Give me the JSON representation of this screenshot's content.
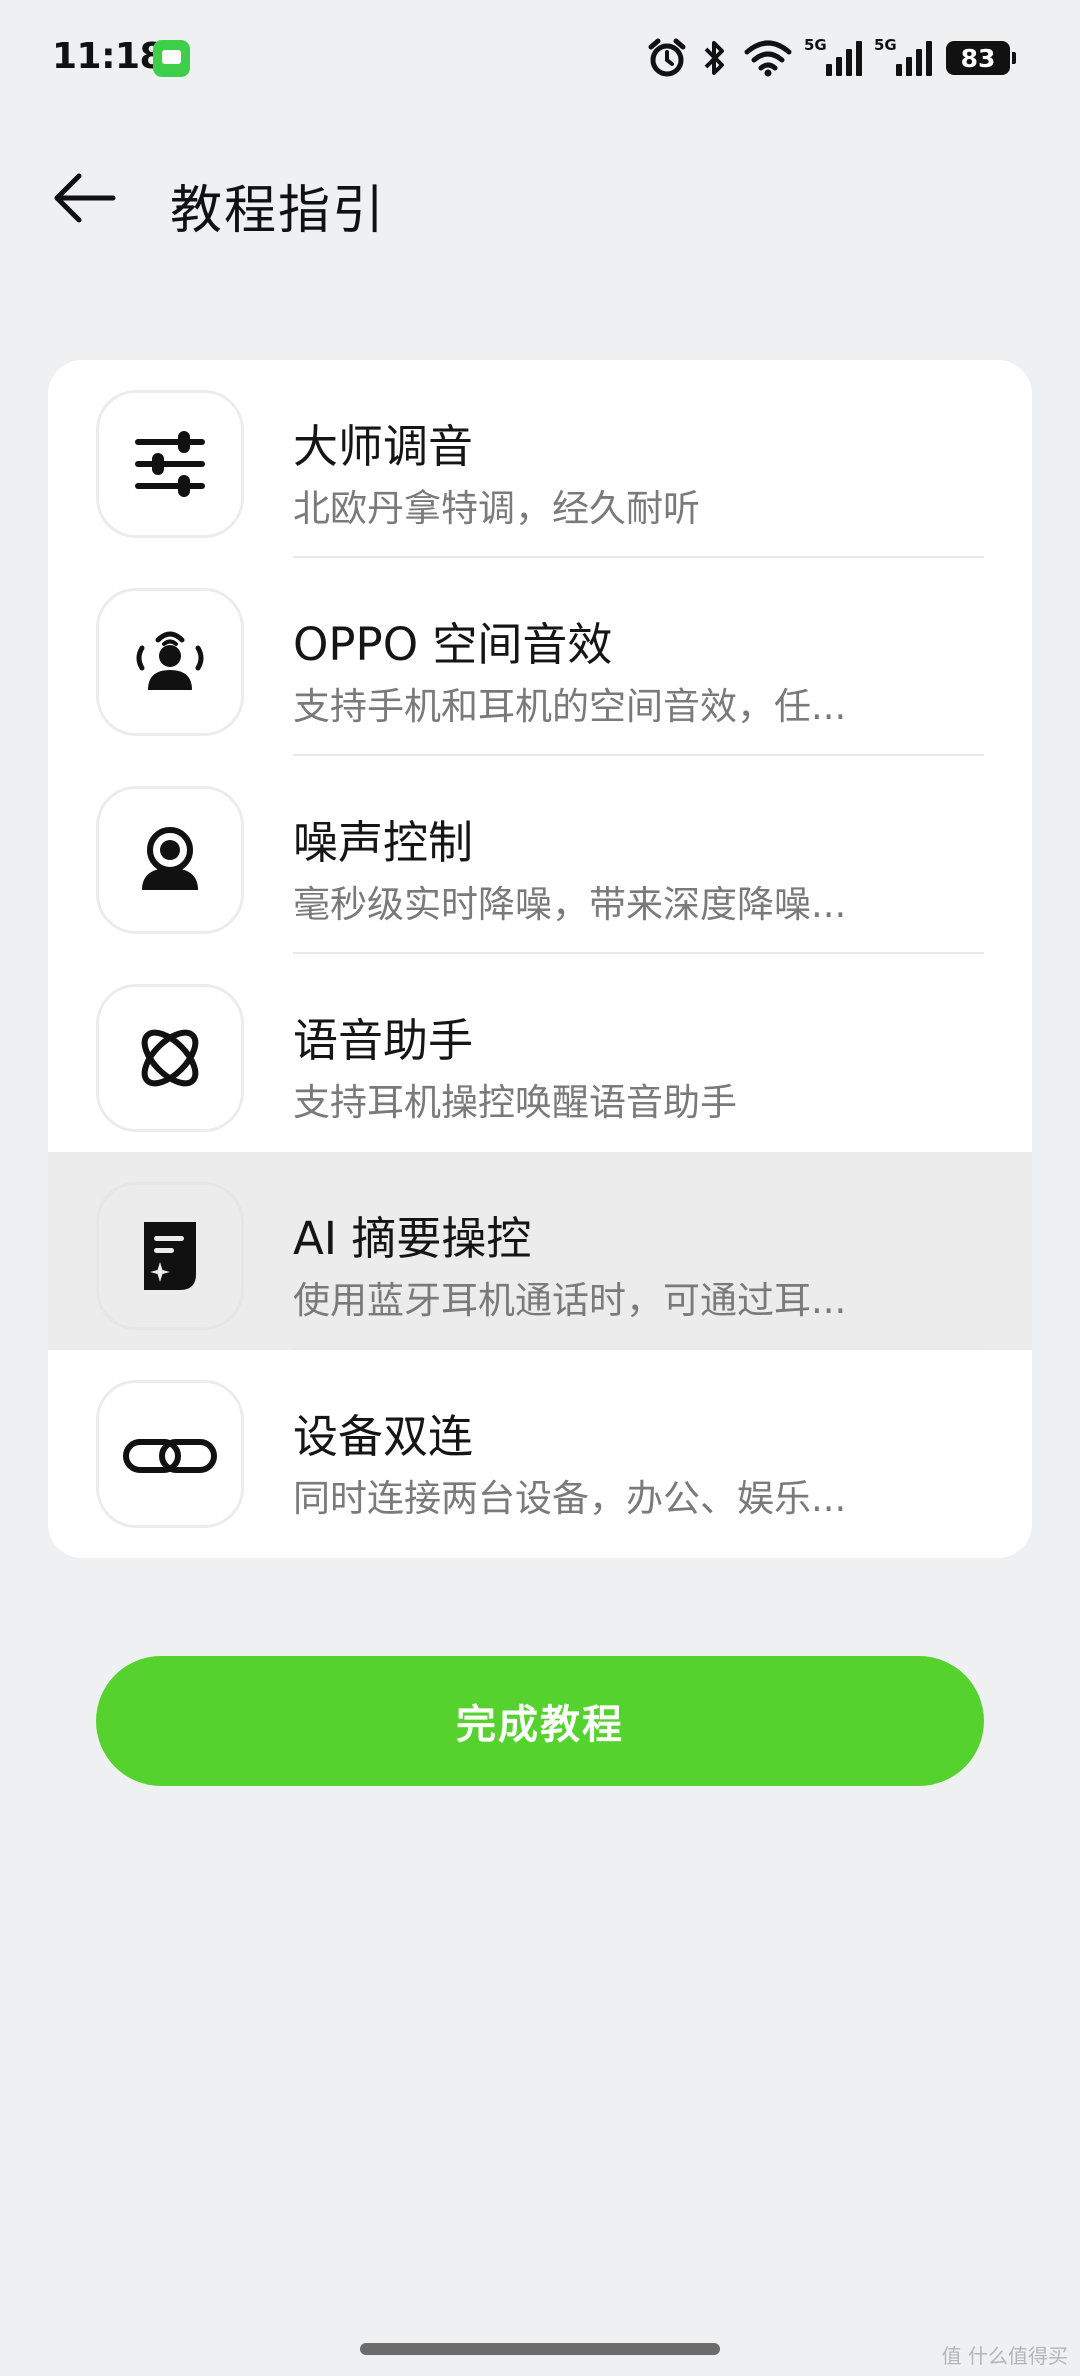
{
  "status_bar": {
    "time": "11:18",
    "network_labels": [
      "5G",
      "5G"
    ],
    "battery": "83"
  },
  "header": {
    "title": "教程指引"
  },
  "items": [
    {
      "title": "大师调音",
      "subtitle": "北欧丹拿特调，经久耐听",
      "icon": "equalizer-sliders-icon"
    },
    {
      "title": "OPPO 空间音效",
      "subtitle": "支持手机和耳机的空间音效，任...",
      "icon": "spatial-audio-icon"
    },
    {
      "title": "噪声控制",
      "subtitle": "毫秒级实时降噪，带来深度降噪...",
      "icon": "noise-control-icon"
    },
    {
      "title": "语音助手",
      "subtitle": "支持耳机操控唤醒语音助手",
      "icon": "voice-assistant-icon"
    },
    {
      "title": "AI 摘要操控",
      "subtitle": "使用蓝牙耳机通话时，可通过耳...",
      "icon": "ai-summary-doc-icon"
    },
    {
      "title": "设备双连",
      "subtitle": "同时连接两台设备，办公、娱乐...",
      "icon": "link-icon"
    }
  ],
  "finish_button": {
    "label": "完成教程"
  },
  "watermark": "值 什么值得买",
  "colors": {
    "background": "#eff0f2",
    "accent_green": "#55d22d",
    "highlight_row": "#ececec"
  }
}
